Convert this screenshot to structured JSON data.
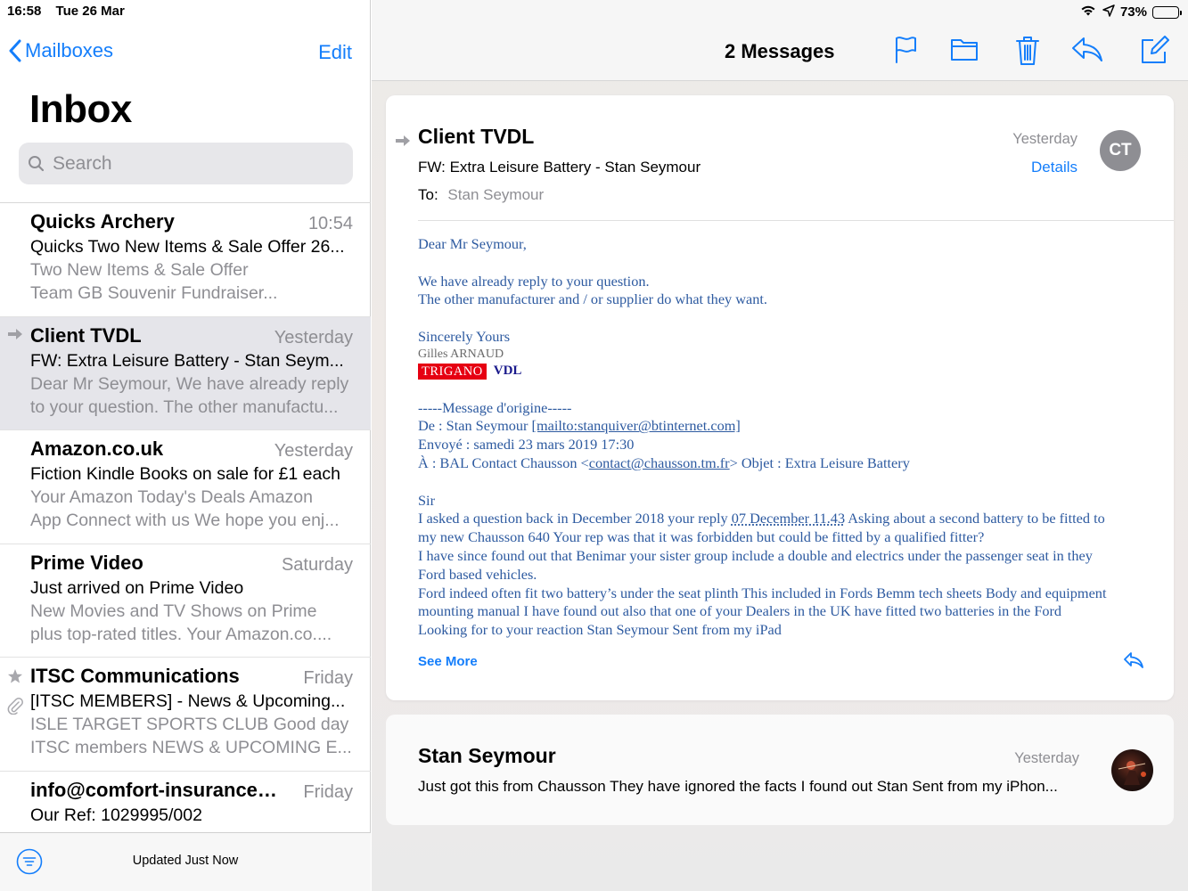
{
  "status": {
    "time": "16:58",
    "date": "Tue 26 Mar",
    "battery": "73%",
    "battery_level": 0.73
  },
  "sidebar": {
    "back_label": "Mailboxes",
    "edit_label": "Edit",
    "title": "Inbox",
    "search_placeholder": "Search",
    "messages": [
      {
        "sender": "Quicks Archery",
        "date": "10:54",
        "subject": "Quicks Two New Items & Sale Offer 26...",
        "preview1": "Two New Items & Sale Offer",
        "preview2": "Team GB Souvenir Fundraiser..."
      },
      {
        "sender": "Client TVDL",
        "date": "Yesterday",
        "subject": "FW: Extra Leisure Battery  - Stan Seym...",
        "preview1": "Dear Mr Seymour, We have already reply",
        "preview2": "to your question. The other manufactu..."
      },
      {
        "sender": "Amazon.co.uk",
        "date": "Yesterday",
        "subject": "Fiction Kindle Books on sale for £1 each",
        "preview1": "Your Amazon Today's Deals Amazon",
        "preview2": "App Connect with us We hope you enj..."
      },
      {
        "sender": "Prime Video",
        "date": "Saturday",
        "subject": "Just arrived on Prime Video",
        "preview1": "New Movies and TV Shows on Prime",
        "preview2": "plus top-rated titles. Your Amazon.co...."
      },
      {
        "sender": "ITSC Communications",
        "date": "Friday",
        "subject": "[ITSC MEMBERS] - News & Upcoming...",
        "preview1": "ISLE TARGET SPORTS CLUB Good day",
        "preview2": "ITSC members NEWS & UPCOMING E..."
      },
      {
        "sender": "info@comfort-insurance.c...",
        "date": "Friday",
        "subject": "Our Ref: 1029995/002",
        "preview1": "",
        "preview2": ""
      }
    ],
    "updated_text": "Updated Just Now"
  },
  "detail": {
    "header_title": "2 Messages",
    "message1": {
      "sender": "Client TVDL",
      "subject": "FW: Extra Leisure Battery  - Stan Seymour",
      "to_label": "To:",
      "to_name": "Stan Seymour",
      "date": "Yesterday",
      "details_label": "Details",
      "avatar_initials": "CT",
      "body": {
        "greeting": "Dear Mr Seymour,",
        "p1_line1": "We have already reply to your question.",
        "p1_line2": "The other manufacturer and / or supplier do what they want.",
        "sign_off": "Sincerely Yours",
        "sign_name": "Gilles ARNAUD",
        "logo_trigano": "TRIGANO",
        "logo_vdl": "VDL",
        "orig_header": "-----Message d'origine-----",
        "de_prefix": "De : Stan Seymour ",
        "de_link": "[mailto:stanquiver@btinternet.com]",
        "envoye": "Envoyé : samedi 23 mars 2019 17:30",
        "a_prefix": "À : BAL Contact Chausson <",
        "a_link": "contact@chausson.tm.fr",
        "a_suffix": "> Objet : Extra Leisure Battery",
        "sir": "Sir",
        "l1_pre": "I asked a question back in December 2018 your reply ",
        "l1_link": "07 December 11.43",
        "l1_post": " Asking about a second battery to be fitted to",
        "l2": "my new Chausson 640 Your rep was that it was forbidden but could be fitted by a qualified fitter?",
        "l3": "I have since found out that Benimar your sister group include a double and electrics under the passenger seat in they",
        "l4": "Ford based vehicles.",
        "l5": "Ford indeed often fit two battery’s under the seat plinth This included in Fords Bemm tech sheets Body and equipment",
        "l6": "mounting manual I have found out also that one of your Dealers in the UK have fitted two batteries in the Ford",
        "l7": "Looking for to your reaction Stan Seymour Sent from my iPad"
      },
      "see_more": "See More"
    },
    "message2": {
      "sender": "Stan Seymour",
      "date": "Yesterday",
      "preview": "Just got this from Chausson They have ignored the facts I found out Stan Sent from my iPhon..."
    }
  },
  "colors": {
    "accent": "#147efb",
    "body_text": "#2d5aa0",
    "trigano_red": "#e60012"
  }
}
